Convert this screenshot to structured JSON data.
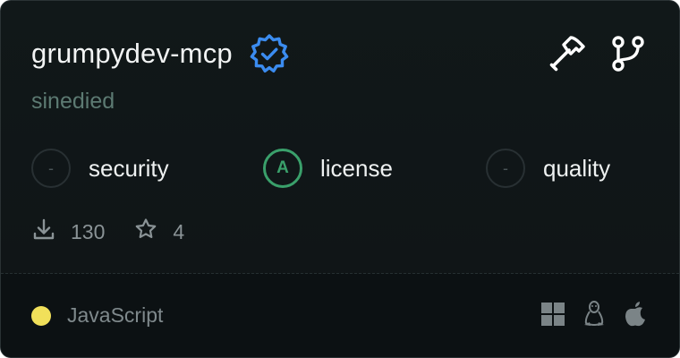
{
  "server": {
    "name": "grumpydev-mcp",
    "author": "sinedied",
    "verified_color": "#3b8cf0"
  },
  "scores": [
    {
      "grade": "-",
      "label": "security"
    },
    {
      "grade": "A",
      "label": "license",
      "color": "#3aa06b"
    },
    {
      "grade": "-",
      "label": "quality"
    }
  ],
  "stats": {
    "downloads": "130",
    "stars": "4"
  },
  "footer": {
    "language": "JavaScript",
    "language_color": "#f1e05a",
    "platforms": [
      "windows-icon",
      "linux-icon",
      "apple-icon"
    ]
  },
  "actions": [
    "hammer-icon",
    "git-branch-icon"
  ]
}
